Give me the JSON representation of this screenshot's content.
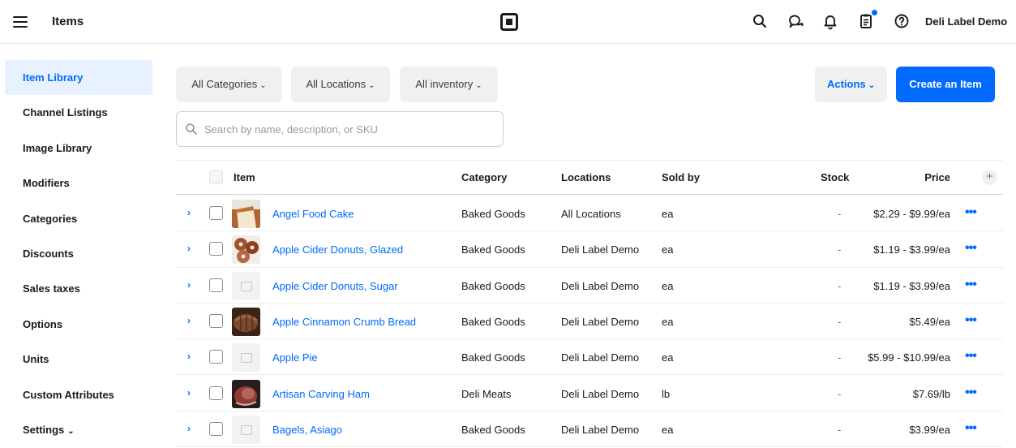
{
  "header": {
    "title": "Items",
    "account_name": "Deli Label Demo",
    "icons": [
      "menu-icon",
      "square-logo",
      "search-icon",
      "chat-icon",
      "bell-icon",
      "clipboard-icon",
      "help-icon"
    ]
  },
  "sidebar": {
    "items": [
      {
        "label": "Item Library",
        "active": true
      },
      {
        "label": "Channel Listings"
      },
      {
        "label": "Image Library"
      },
      {
        "label": "Modifiers"
      },
      {
        "label": "Categories"
      },
      {
        "label": "Discounts"
      },
      {
        "label": "Sales taxes"
      },
      {
        "label": "Options"
      },
      {
        "label": "Units"
      },
      {
        "label": "Custom Attributes"
      },
      {
        "label": "Settings"
      }
    ]
  },
  "toolbar": {
    "filter_categories": "All Categories",
    "filter_locations": "All Locations",
    "filter_inventory": "All inventory",
    "actions_label": "Actions",
    "create_label": "Create an Item",
    "search_placeholder": "Search by name, description, or SKU"
  },
  "table": {
    "columns": {
      "item": "Item",
      "category": "Category",
      "locations": "Locations",
      "sold_by": "Sold by",
      "stock": "Stock",
      "price": "Price"
    },
    "rows": [
      {
        "name": "Angel Food Cake",
        "category": "Baked Goods",
        "locations": "All Locations",
        "sold_by": "ea",
        "stock": "-",
        "price": "$2.29 - $9.99/ea",
        "image": "cake"
      },
      {
        "name": "Apple Cider Donuts, Glazed",
        "category": "Baked Goods",
        "locations": "Deli Label Demo",
        "sold_by": "ea",
        "stock": "-",
        "price": "$1.19 - $3.99/ea",
        "image": "donuts"
      },
      {
        "name": "Apple Cider Donuts, Sugar",
        "category": "Baked Goods",
        "locations": "Deli Label Demo",
        "sold_by": "ea",
        "stock": "-",
        "price": "$1.19 - $3.99/ea",
        "image": "none"
      },
      {
        "name": "Apple Cinnamon Crumb Bread",
        "category": "Baked Goods",
        "locations": "Deli Label Demo",
        "sold_by": "ea",
        "stock": "-",
        "price": "$5.49/ea",
        "image": "bread"
      },
      {
        "name": "Apple Pie",
        "category": "Baked Goods",
        "locations": "Deli Label Demo",
        "sold_by": "ea",
        "stock": "-",
        "price": "$5.99 - $10.99/ea",
        "image": "none"
      },
      {
        "name": "Artisan Carving Ham",
        "category": "Deli Meats",
        "locations": "Deli Label Demo",
        "sold_by": "lb",
        "stock": "-",
        "price": "$7.69/lb",
        "image": "ham"
      },
      {
        "name": "Bagels, Asiago",
        "category": "Baked Goods",
        "locations": "Deli Label Demo",
        "sold_by": "ea",
        "stock": "-",
        "price": "$3.99/ea",
        "image": "none"
      }
    ]
  },
  "colors": {
    "accent": "#006aff",
    "active_bg": "#e8f1ff"
  }
}
